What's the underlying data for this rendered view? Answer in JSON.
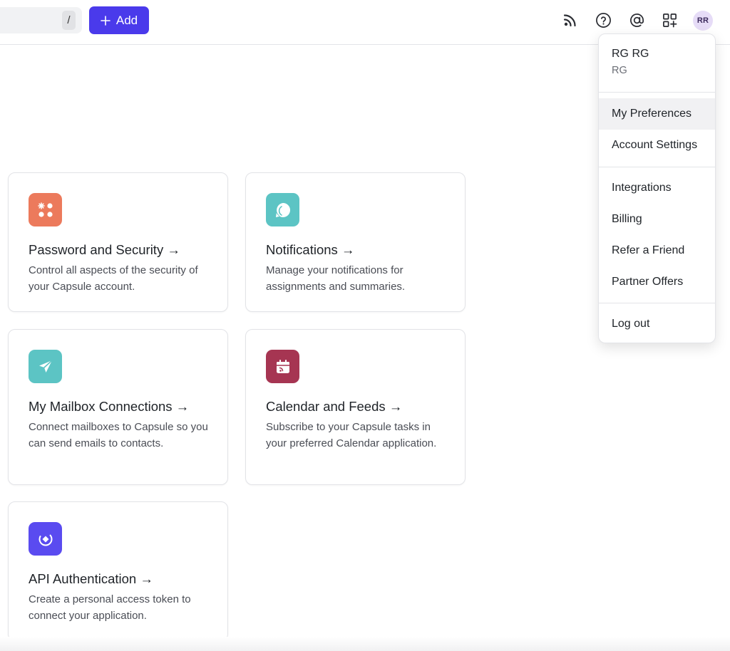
{
  "toolbar": {
    "search_shortcut": "/",
    "add_label": "Add",
    "avatar_initials": "RR"
  },
  "cards": [
    {
      "title": "Password and Security →",
      "description": "Control all aspects of the security of your Capsule account.",
      "icon": "security-dots-icon",
      "color": "#ec7a5c"
    },
    {
      "title": "Notifications →",
      "description": "Manage your notifications for assignments and summaries.",
      "icon": "notification-bubble-icon",
      "color": "#5cc4c4"
    },
    {
      "title": "My Mailbox Connections →",
      "description": "Connect mailboxes to Capsule so you can send emails to contacts.",
      "icon": "send-icon",
      "color": "#5cc4c4"
    },
    {
      "title": "Calendar and Feeds →",
      "description": "Subscribe to your Capsule tasks in your preferred Calendar application.",
      "icon": "calendar-feed-icon",
      "color": "#a63552"
    },
    {
      "title": "API Authentication →",
      "description": "Create a personal access token to connect your application.",
      "icon": "api-icon",
      "color": "#5a4bf0"
    }
  ],
  "user_menu": {
    "name": "RG RG",
    "subtitle": "RG",
    "items": [
      {
        "label": "My Preferences"
      },
      {
        "label": "Account Settings"
      },
      {
        "label": "Integrations"
      },
      {
        "label": "Billing"
      },
      {
        "label": "Refer a Friend"
      },
      {
        "label": "Partner Offers"
      },
      {
        "label": "Log out"
      }
    ]
  },
  "colors": {
    "accent": "#4a3aeb",
    "menu_active_bg": "#f1f1f3"
  }
}
